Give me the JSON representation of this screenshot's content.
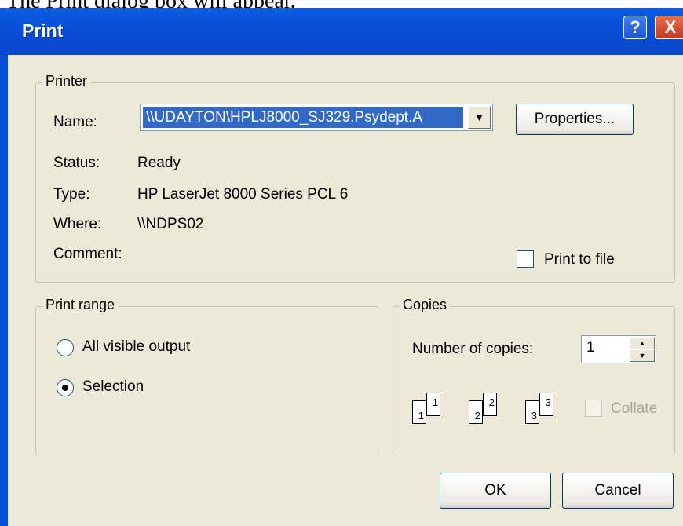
{
  "caption": "The Print dialog box will appear.",
  "window": {
    "title": "Print",
    "help_label": "?",
    "close_label": "X"
  },
  "printer": {
    "group_label": "Printer",
    "name_label": "Name:",
    "name_value": "\\\\UDAYTON\\HPLJ8000_SJ329.Psydept.A",
    "properties_label": "Properties...",
    "status_label": "Status:",
    "status_value": "Ready",
    "type_label": "Type:",
    "type_value": "HP LaserJet 8000 Series PCL 6",
    "where_label": "Where:",
    "where_value": "\\\\NDPS02",
    "comment_label": "Comment:",
    "comment_value": "",
    "print_to_file_label": "Print to file",
    "print_to_file_checked": false
  },
  "print_range": {
    "group_label": "Print range",
    "options": [
      "All visible output",
      "Selection"
    ],
    "selected": "Selection"
  },
  "copies": {
    "group_label": "Copies",
    "number_label": "Number of copies:",
    "number_value": "1",
    "collate_label": "Collate",
    "collate_enabled": false,
    "pages": [
      "1",
      "1",
      "2",
      "2",
      "3",
      "3"
    ]
  },
  "buttons": {
    "ok": "OK",
    "cancel": "Cancel"
  },
  "icons": {
    "dropdown": "chevron-down-icon",
    "spin_up": "arrow-up-icon",
    "spin_down": "arrow-down-icon"
  }
}
